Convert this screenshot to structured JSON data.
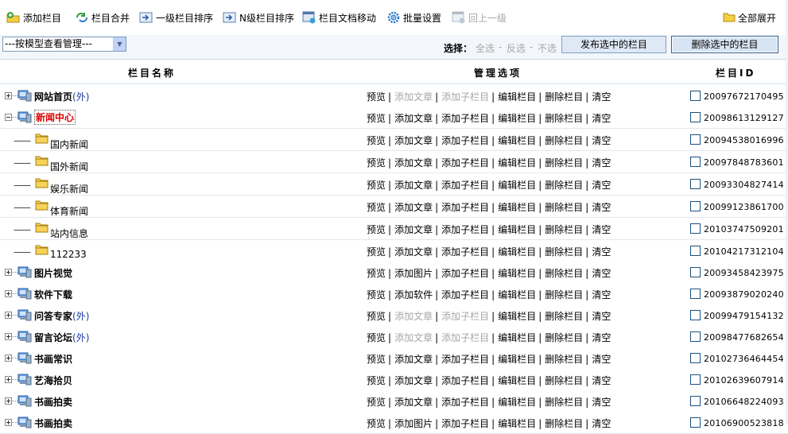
{
  "toolbar": {
    "items": [
      {
        "label": "添加栏目",
        "icon": "add-folder-icon",
        "enabled": true
      },
      {
        "label": "栏目合并",
        "icon": "merge-icon",
        "enabled": true
      },
      {
        "label": "一级栏目排序",
        "icon": "sort-icon",
        "enabled": true
      },
      {
        "label": "N级栏目排序",
        "icon": "sort-n-icon",
        "enabled": true
      },
      {
        "label": "栏目文档移动",
        "icon": "move-docs-icon",
        "enabled": true
      },
      {
        "label": "批量设置",
        "icon": "gear-icon",
        "enabled": true
      },
      {
        "label": "回上一级",
        "icon": "back-up-icon",
        "enabled": false
      }
    ],
    "expand_all": "全部展开"
  },
  "filter": {
    "select_value": "---按模型查看管理---",
    "select_label": "选择：",
    "select_all": "全选",
    "invert": "反选",
    "select_none": "不选",
    "separator": "-",
    "publish_button": "发布选中的栏目",
    "delete_button": "删除选中的栏目"
  },
  "columns": {
    "name": "栏目名称",
    "ops": "管理选项",
    "id": "栏目ID"
  },
  "rows": [
    {
      "type": "top",
      "name": "网站首页",
      "ext": "(外)",
      "selected": false,
      "ops": [
        [
          "预览",
          true
        ],
        [
          "添加文章",
          false
        ],
        [
          "添加子栏目",
          false
        ],
        [
          "编辑栏目",
          true
        ],
        [
          "删除栏目",
          true
        ],
        [
          "清空",
          true
        ]
      ],
      "id": "20097672170495"
    },
    {
      "type": "top",
      "name": "新闻中心",
      "ext": "",
      "selected": true,
      "expanded": true,
      "ops": [
        [
          "预览",
          true
        ],
        [
          "添加文章",
          true
        ],
        [
          "添加子栏目",
          true
        ],
        [
          "编辑栏目",
          true
        ],
        [
          "删除栏目",
          true
        ],
        [
          "清空",
          true
        ]
      ],
      "id": "20098613129127"
    },
    {
      "type": "sub",
      "name": "国内新闻",
      "ops": [
        [
          "预览",
          true
        ],
        [
          "添加文章",
          true
        ],
        [
          "添加子栏目",
          true
        ],
        [
          "编辑栏目",
          true
        ],
        [
          "删除栏目",
          true
        ],
        [
          "清空",
          true
        ]
      ],
      "id": "20094538016996"
    },
    {
      "type": "sub",
      "name": "国外新闻",
      "ops": [
        [
          "预览",
          true
        ],
        [
          "添加文章",
          true
        ],
        [
          "添加子栏目",
          true
        ],
        [
          "编辑栏目",
          true
        ],
        [
          "删除栏目",
          true
        ],
        [
          "清空",
          true
        ]
      ],
      "id": "20097848783601"
    },
    {
      "type": "sub",
      "name": "娱乐新闻",
      "ops": [
        [
          "预览",
          true
        ],
        [
          "添加文章",
          true
        ],
        [
          "添加子栏目",
          true
        ],
        [
          "编辑栏目",
          true
        ],
        [
          "删除栏目",
          true
        ],
        [
          "清空",
          true
        ]
      ],
      "id": "20093304827414"
    },
    {
      "type": "sub",
      "name": "体育新闻",
      "ops": [
        [
          "预览",
          true
        ],
        [
          "添加文章",
          true
        ],
        [
          "添加子栏目",
          true
        ],
        [
          "编辑栏目",
          true
        ],
        [
          "删除栏目",
          true
        ],
        [
          "清空",
          true
        ]
      ],
      "id": "20099123861700"
    },
    {
      "type": "sub",
      "name": "站内信息",
      "ops": [
        [
          "预览",
          true
        ],
        [
          "添加文章",
          true
        ],
        [
          "添加子栏目",
          true
        ],
        [
          "编辑栏目",
          true
        ],
        [
          "删除栏目",
          true
        ],
        [
          "清空",
          true
        ]
      ],
      "id": "20103747509201"
    },
    {
      "type": "sub",
      "name": "112233",
      "ops": [
        [
          "预览",
          true
        ],
        [
          "添加文章",
          true
        ],
        [
          "添加子栏目",
          true
        ],
        [
          "编辑栏目",
          true
        ],
        [
          "删除栏目",
          true
        ],
        [
          "清空",
          true
        ]
      ],
      "id": "20104217312104"
    },
    {
      "type": "top",
      "name": "图片视觉",
      "ext": "",
      "selected": false,
      "ops": [
        [
          "预览",
          true
        ],
        [
          "添加图片",
          true
        ],
        [
          "添加子栏目",
          true
        ],
        [
          "编辑栏目",
          true
        ],
        [
          "删除栏目",
          true
        ],
        [
          "清空",
          true
        ]
      ],
      "id": "20093458423975"
    },
    {
      "type": "top",
      "name": "软件下载",
      "ext": "",
      "selected": false,
      "ops": [
        [
          "预览",
          true
        ],
        [
          "添加软件",
          true
        ],
        [
          "添加子栏目",
          true
        ],
        [
          "编辑栏目",
          true
        ],
        [
          "删除栏目",
          true
        ],
        [
          "清空",
          true
        ]
      ],
      "id": "20093879020240"
    },
    {
      "type": "top",
      "name": "问答专家",
      "ext": "(外)",
      "selected": false,
      "ops": [
        [
          "预览",
          true
        ],
        [
          "添加文章",
          false
        ],
        [
          "添加子栏目",
          false
        ],
        [
          "编辑栏目",
          true
        ],
        [
          "删除栏目",
          true
        ],
        [
          "清空",
          true
        ]
      ],
      "id": "20099479154132"
    },
    {
      "type": "top",
      "name": "留言论坛",
      "ext": "(外)",
      "selected": false,
      "ops": [
        [
          "预览",
          true
        ],
        [
          "添加文章",
          false
        ],
        [
          "添加子栏目",
          false
        ],
        [
          "编辑栏目",
          true
        ],
        [
          "删除栏目",
          true
        ],
        [
          "清空",
          true
        ]
      ],
      "id": "20098477682654"
    },
    {
      "type": "top",
      "name": "书画常识",
      "ext": "",
      "selected": false,
      "ops": [
        [
          "预览",
          true
        ],
        [
          "添加文章",
          true
        ],
        [
          "添加子栏目",
          true
        ],
        [
          "编辑栏目",
          true
        ],
        [
          "删除栏目",
          true
        ],
        [
          "清空",
          true
        ]
      ],
      "id": "20102736464454"
    },
    {
      "type": "top",
      "name": "艺海拾贝",
      "ext": "",
      "selected": false,
      "ops": [
        [
          "预览",
          true
        ],
        [
          "添加文章",
          true
        ],
        [
          "添加子栏目",
          true
        ],
        [
          "编辑栏目",
          true
        ],
        [
          "删除栏目",
          true
        ],
        [
          "清空",
          true
        ]
      ],
      "id": "20102639607914"
    },
    {
      "type": "top",
      "name": "书画拍卖",
      "ext": "",
      "selected": false,
      "ops": [
        [
          "预览",
          true
        ],
        [
          "添加文章",
          true
        ],
        [
          "添加子栏目",
          true
        ],
        [
          "编辑栏目",
          true
        ],
        [
          "删除栏目",
          true
        ],
        [
          "清空",
          true
        ]
      ],
      "id": "20106648224093"
    },
    {
      "type": "top",
      "name": "书画拍卖",
      "ext": "",
      "selected": false,
      "ops": [
        [
          "预览",
          true
        ],
        [
          "添加图片",
          true
        ],
        [
          "添加子栏目",
          true
        ],
        [
          "编辑栏目",
          true
        ],
        [
          "删除栏目",
          true
        ],
        [
          "清空",
          true
        ]
      ],
      "id": "20106900523818"
    }
  ],
  "colors": {
    "selected_name": "#e00000",
    "disabled": "#a6a6a6",
    "ext_link": "#1f3b9a"
  }
}
